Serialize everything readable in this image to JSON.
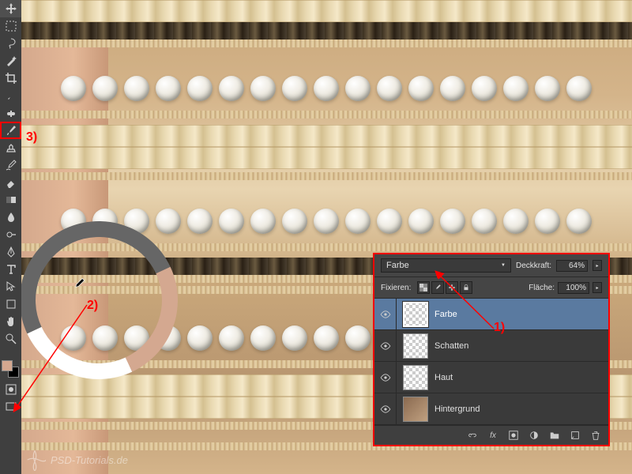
{
  "annotations": {
    "a1": "1)",
    "a2": "2)",
    "a3": "3)"
  },
  "layersPanel": {
    "blendMode": "Farbe",
    "opacityLabel": "Deckkraft:",
    "opacityValue": "64%",
    "lockLabel": "Fixieren:",
    "fillLabel": "Fläche:",
    "fillValue": "100%",
    "layers": [
      {
        "name": "Farbe"
      },
      {
        "name": "Schatten"
      },
      {
        "name": "Haut"
      },
      {
        "name": "Hintergrund"
      }
    ],
    "footerFx": "fx"
  },
  "watermark": "PSD-Tutorials.de",
  "colors": {
    "foreground": "#d4a890",
    "background": "#000000",
    "accent": "#ff0000"
  }
}
